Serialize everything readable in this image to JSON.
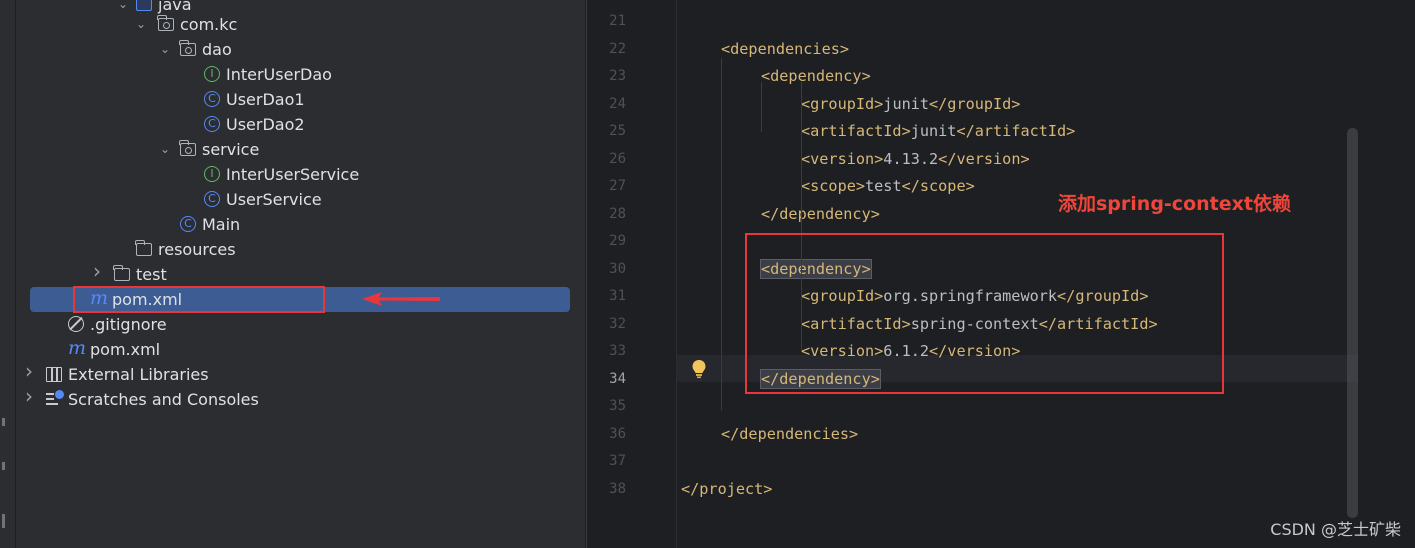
{
  "project_tree": {
    "items": [
      {
        "label": "java",
        "kind": "source-folder",
        "chevron": "down"
      },
      {
        "label": "com.kc",
        "kind": "package",
        "chevron": "down"
      },
      {
        "label": "dao",
        "kind": "package",
        "chevron": "down"
      },
      {
        "label": "InterUserDao",
        "kind": "interface"
      },
      {
        "label": "UserDao1",
        "kind": "class"
      },
      {
        "label": "UserDao2",
        "kind": "class"
      },
      {
        "label": "service",
        "kind": "package",
        "chevron": "down"
      },
      {
        "label": "InterUserService",
        "kind": "interface"
      },
      {
        "label": "UserService",
        "kind": "class"
      },
      {
        "label": "Main",
        "kind": "class"
      },
      {
        "label": "resources",
        "kind": "resources-folder"
      },
      {
        "label": "test",
        "kind": "folder",
        "chevron": "right"
      },
      {
        "label": "pom.xml",
        "kind": "maven",
        "selected": true
      },
      {
        "label": ".gitignore",
        "kind": "ignore"
      },
      {
        "label": "pom.xml",
        "kind": "maven"
      },
      {
        "label": "External Libraries",
        "kind": "libraries",
        "chevron": "right"
      },
      {
        "label": "Scratches and Consoles",
        "kind": "scratches",
        "chevron": "right"
      }
    ]
  },
  "editor": {
    "current_line": 34,
    "lines": [
      {
        "n": "21",
        "indent": 0,
        "tag_open": "",
        "text": "",
        "tag_close": ""
      },
      {
        "n": "22",
        "indent": 1,
        "tag_open": "<dependencies>",
        "text": "",
        "tag_close": ""
      },
      {
        "n": "23",
        "indent": 2,
        "tag_open": "<dependency>",
        "text": "",
        "tag_close": ""
      },
      {
        "n": "24",
        "indent": 3,
        "tag_open": "<groupId>",
        "text": "junit",
        "tag_close": "</groupId>"
      },
      {
        "n": "25",
        "indent": 3,
        "tag_open": "<artifactId>",
        "text": "junit",
        "tag_close": "</artifactId>"
      },
      {
        "n": "26",
        "indent": 3,
        "tag_open": "<version>",
        "text": "4.13.2",
        "tag_close": "</version>"
      },
      {
        "n": "27",
        "indent": 3,
        "tag_open": "<scope>",
        "text": "test",
        "tag_close": "</scope>"
      },
      {
        "n": "28",
        "indent": 2,
        "tag_open": "</dependency>",
        "text": "",
        "tag_close": ""
      },
      {
        "n": "29",
        "indent": 0,
        "tag_open": "",
        "text": "",
        "tag_close": ""
      },
      {
        "n": "30",
        "indent": 2,
        "tag_open": "<dependency>",
        "text": "",
        "tag_close": "",
        "highlight": true
      },
      {
        "n": "31",
        "indent": 3,
        "tag_open": "<groupId>",
        "text": "org.springframework",
        "tag_close": "</groupId>"
      },
      {
        "n": "32",
        "indent": 3,
        "tag_open": "<artifactId>",
        "text": "spring-context",
        "tag_close": "</artifactId>"
      },
      {
        "n": "33",
        "indent": 3,
        "tag_open": "<version>",
        "text": "6.1.2",
        "tag_close": "</version>"
      },
      {
        "n": "34",
        "indent": 2,
        "tag_open": "</dependency>",
        "text": "",
        "tag_close": "",
        "highlight": true
      },
      {
        "n": "35",
        "indent": 0,
        "tag_open": "",
        "text": "",
        "tag_close": ""
      },
      {
        "n": "36",
        "indent": 1,
        "tag_open": "</dependencies>",
        "text": "",
        "tag_close": ""
      },
      {
        "n": "37",
        "indent": 0,
        "tag_open": "",
        "text": "",
        "tag_close": ""
      },
      {
        "n": "38",
        "indent": 0,
        "tag_open": "</project>",
        "text": "",
        "tag_close": ""
      }
    ]
  },
  "annotation": {
    "text": "添加spring-context依赖",
    "color": "#f0463a"
  },
  "watermark": "CSDN @芝士矿柴",
  "colors": {
    "tag": "#d5b778",
    "text": "#bcbec4",
    "selection": "#3d5c94",
    "callout_red": "#e8373b",
    "class_icon": "#548af7",
    "interface_icon": "#5fb865"
  }
}
